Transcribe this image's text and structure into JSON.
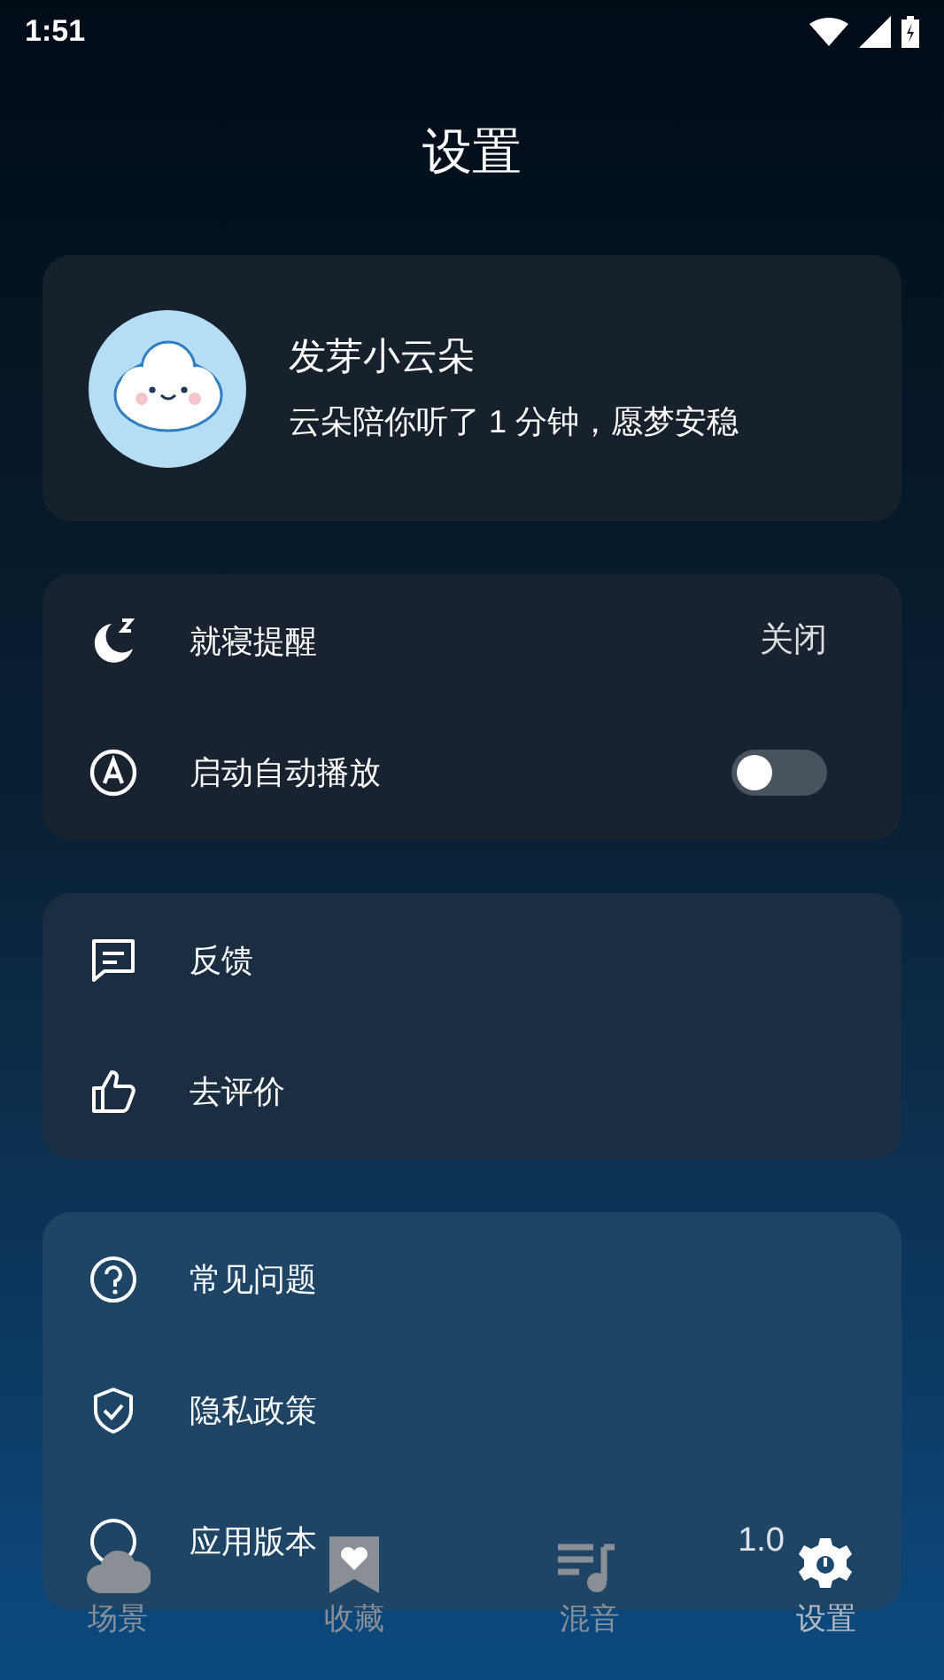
{
  "status_bar": {
    "time": "1:51"
  },
  "title": "设置",
  "profile": {
    "name": "发芽小云朵",
    "message": "云朵陪你听了 1 分钟，愿梦安稳"
  },
  "groups": [
    {
      "rows": [
        {
          "kind": "value",
          "label": "就寝提醒",
          "value": "关闭"
        },
        {
          "kind": "toggle",
          "label": "启动自动播放",
          "on": false
        }
      ]
    },
    {
      "rows": [
        {
          "kind": "link",
          "label": "反馈"
        },
        {
          "kind": "link",
          "label": "去评价"
        }
      ]
    },
    {
      "rows": [
        {
          "kind": "link",
          "label": "常见问题"
        },
        {
          "kind": "link",
          "label": "隐私政策"
        },
        {
          "kind": "value",
          "label": "应用版本",
          "value": "1.0"
        }
      ]
    }
  ],
  "nav": [
    {
      "label": "场景",
      "selected": false
    },
    {
      "label": "收藏",
      "selected": false
    },
    {
      "label": "混音",
      "selected": false
    },
    {
      "label": "设置",
      "selected": true
    }
  ]
}
